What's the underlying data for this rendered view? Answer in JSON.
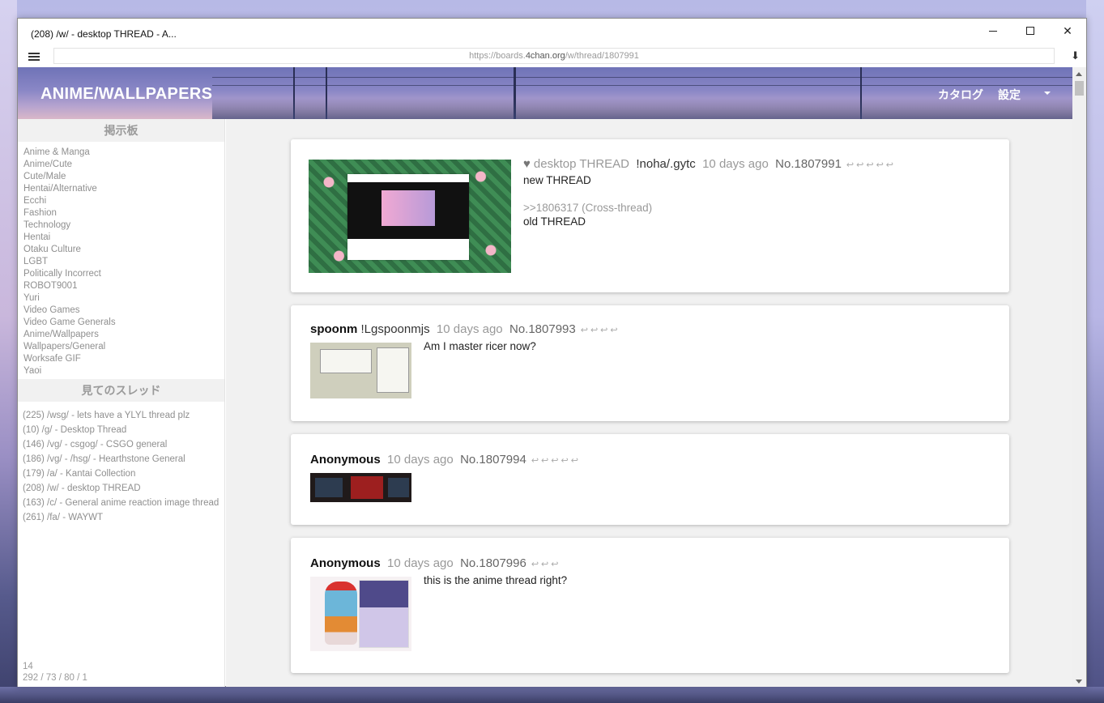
{
  "window": {
    "title": "(208) /w/ - desktop THREAD - A...",
    "url_prefix": "https://boards.",
    "url_host": "4chan.org",
    "url_path": "/w/thread/1807991"
  },
  "header": {
    "site_title": "ANIME/WALLPAPERS",
    "catalog": "カタログ",
    "settings": "設定"
  },
  "sidebar": {
    "boards_heading": "掲示板",
    "boards": [
      "Anime & Manga",
      "Anime/Cute",
      "Cute/Male",
      "Hentai/Alternative",
      "Ecchi",
      "Fashion",
      "Technology",
      "Hentai",
      "Otaku Culture",
      "LGBT",
      "Politically Incorrect",
      "ROBOT9001",
      "Yuri",
      "Video Games",
      "Video Game Generals",
      "Anime/Wallpapers",
      "Wallpapers/General",
      "Worksafe GIF",
      "Yaoi"
    ],
    "watched_heading": "見てのスレッド",
    "watched": [
      "(225) /wsg/ - lets have a YLYL thread plz",
      "(10) /g/ - Desktop Thread",
      "(146) /vg/ - csgog/ - CSGO general",
      "(186) /vg/ - /hsg/ - Hearthstone General",
      "(179) /a/ - Kantai Collection",
      "(208) /w/ - desktop THREAD",
      "(163) /c/ - General anime reaction image thread",
      "(261) /fa/ - WAYWT"
    ],
    "footer_line1": "14",
    "footer_line2": "292 / 73 / 80 / 1"
  },
  "posts": [
    {
      "subject": "desktop THREAD",
      "tripcode": "!noha/.gytc",
      "time": "10 days ago",
      "number": "No.1807991",
      "reply_arrows": "↩↩↩↩↩",
      "line1": "new THREAD",
      "quote": ">>1806317 (Cross-thread)",
      "line2": "old THREAD"
    },
    {
      "name": "spoonm",
      "tripcode": "!Lgspoonmjs",
      "time": "10 days ago",
      "number": "No.1807993",
      "reply_arrows": "↩↩↩↩",
      "text": "Am I master ricer now?"
    },
    {
      "name": "Anonymous",
      "time": "10 days ago",
      "number": "No.1807994",
      "reply_arrows": "↩↩↩↩↩"
    },
    {
      "name": "Anonymous",
      "time": "10 days ago",
      "number": "No.1807996",
      "reply_arrows": "↩↩↩",
      "text": "this is the anime thread right?"
    }
  ]
}
